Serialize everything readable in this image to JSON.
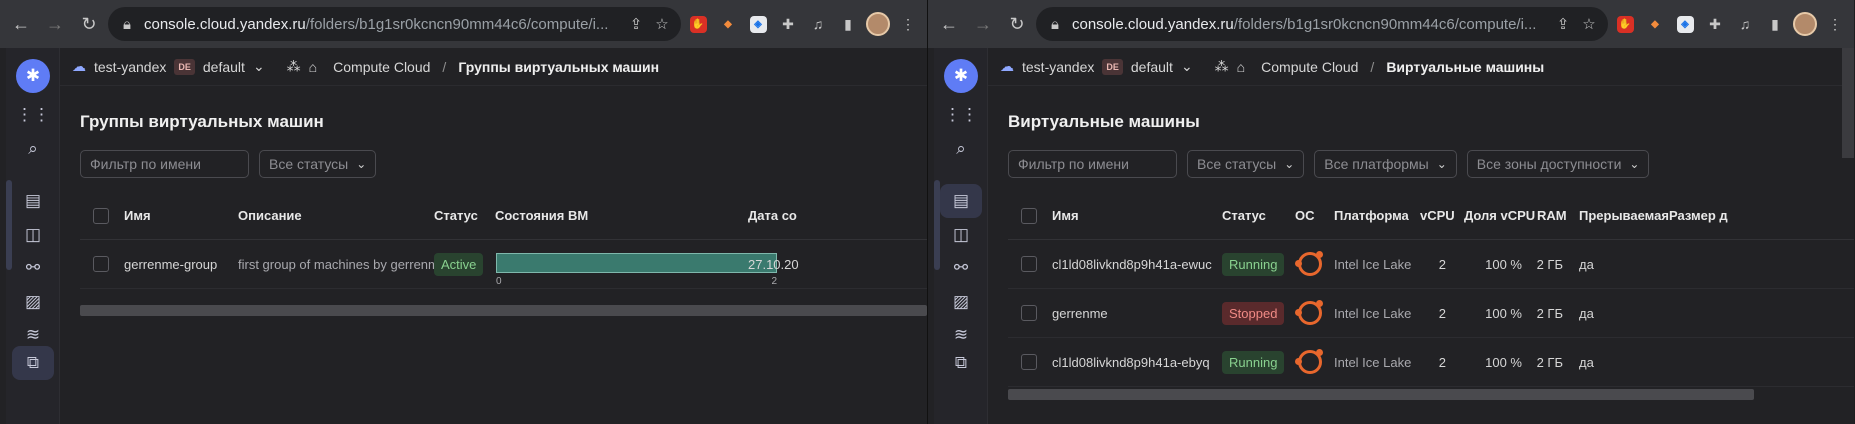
{
  "left": {
    "url_host": "console.cloud.yandex.ru",
    "url_path": "/folders/b1g1sr0kcncn90mm44c6/compute/i...",
    "org": "test-yandex",
    "folder_badge": "DE",
    "folder": "default",
    "crumb_service": "Compute Cloud",
    "crumb_current": "Группы виртуальных машин",
    "title": "Группы виртуальных машин",
    "filter_placeholder": "Фильтр по имени",
    "status_filter": "Все статусы",
    "headers": {
      "name": "Имя",
      "description": "Описание",
      "status": "Статус",
      "vm_states": "Состояния ВМ",
      "date": "Дата со"
    },
    "rows": [
      {
        "name": "gerrenme-group",
        "description": "first group of machines by gerrenme",
        "status": "Active",
        "progress_min": "0",
        "progress_max": "2",
        "progress_fraction": 1.0,
        "date": "27.10.20"
      }
    ]
  },
  "right": {
    "url_host": "console.cloud.yandex.ru",
    "url_path": "/folders/b1g1sr0kcncn90mm44c6/compute/i...",
    "org": "test-yandex",
    "folder_badge": "DE",
    "folder": "default",
    "crumb_service": "Compute Cloud",
    "crumb_current": "Виртуальные машины",
    "title": "Виртуальные машины",
    "filter_placeholder": "Фильтр по имени",
    "status_filter": "Все статусы",
    "platform_filter": "Все платформы",
    "zone_filter": "Все зоны доступности",
    "headers": {
      "name": "Имя",
      "status": "Статус",
      "os": "ОС",
      "platform": "Платформа",
      "vcpu": "vCPU",
      "vcpu_share": "Доля vCPU",
      "ram": "RAM",
      "preemptible": "Прерываемая",
      "disk": "Размер д"
    },
    "rows": [
      {
        "name": "cl1ld08livknd8p9h41a-ewuc",
        "status": "Running",
        "status_color": "green",
        "platform": "Intel Ice Lake",
        "vcpu": "2",
        "share": "100 %",
        "ram": "2 ГБ",
        "preemptible": "да"
      },
      {
        "name": "gerrenme",
        "status": "Stopped",
        "status_color": "red",
        "platform": "Intel Ice Lake",
        "vcpu": "2",
        "share": "100 %",
        "ram": "2 ГБ",
        "preemptible": "да"
      },
      {
        "name": "cl1ld08livknd8p9h41a-ebyq",
        "status": "Running",
        "status_color": "green",
        "platform": "Intel Ice Lake",
        "vcpu": "2",
        "share": "100 %",
        "ram": "2 ГБ",
        "preemptible": "да"
      }
    ]
  },
  "colors": {
    "accent": "#5f7cf5",
    "running": "#89d18f",
    "stopped": "#f08a85",
    "ubuntu": "#e8672d"
  }
}
